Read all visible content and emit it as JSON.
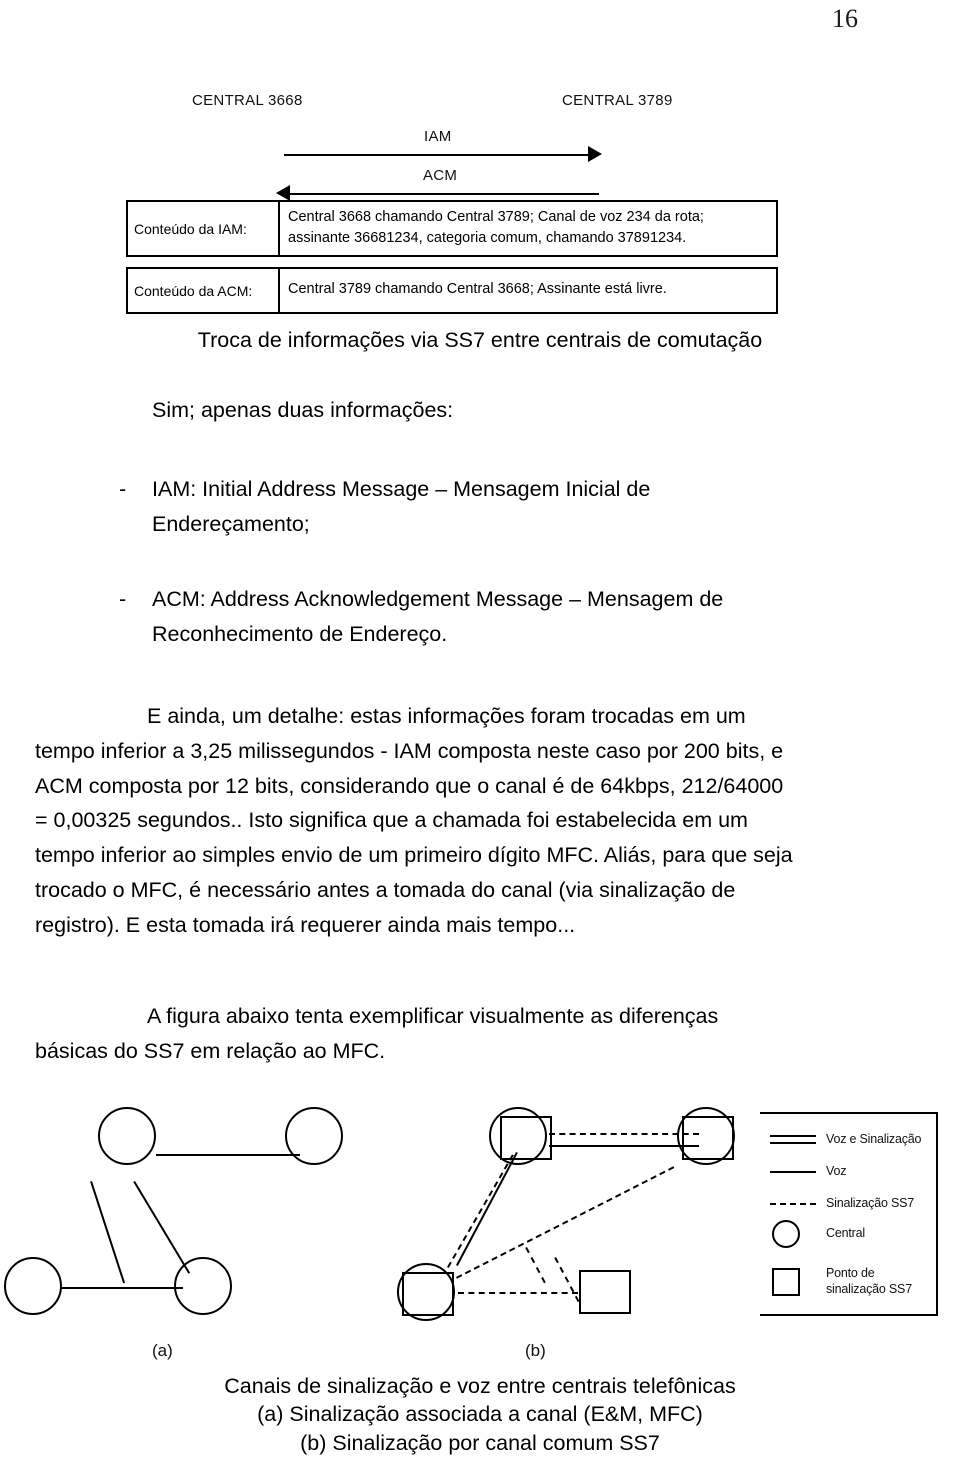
{
  "page": {
    "number": "16"
  },
  "figure_top": {
    "central_left": "CENTRAL 3668",
    "central_right": "CENTRAL 3789",
    "msg_forward": "IAM",
    "msg_backward": "ACM",
    "rows": [
      {
        "label": "Conteúdo da IAM:",
        "line1": "Central 3668 chamando Central 3789; Canal de voz 234 da rota;",
        "line2": "assinante 36681234, categoria comum, chamando 37891234."
      },
      {
        "label": "Conteúdo da ACM:",
        "line1": "Central 3789 chamando Central 3668; Assinante está livre.",
        "line2": ""
      }
    ],
    "caption": "Troca de informações via SS7 entre centrais de comutação"
  },
  "body": {
    "lead": "Sim; apenas duas informações:",
    "bullets": [
      {
        "dash": "-",
        "line1": "IAM: Initial Address Message – Mensagem Inicial de",
        "line2": "Endereçamento;"
      },
      {
        "dash": "-",
        "line1": "ACM: Address Acknowledgement Message – Mensagem de",
        "line2": "Reconhecimento de Endereço."
      }
    ],
    "paragraph_1": {
      "line1": "E ainda, um detalhe: estas informações foram trocadas em um",
      "line2": "tempo inferior a 3,25 milissegundos - IAM composta neste caso por 200 bits, e",
      "line3": "ACM composta por 12 bits, considerando que o canal é de 64kbps, 212/64000",
      "line4": "= 0,00325 segundos.. Isto significa que a chamada foi estabelecida em um",
      "line5": "tempo inferior ao simples envio de um primeiro dígito MFC. Aliás, para que seja",
      "line6": "trocado o MFC, é necessário antes a tomada do canal (via sinalização de",
      "line7": "registro). E esta tomada irá requerer ainda mais tempo..."
    },
    "paragraph_2": {
      "line1": "A figura abaixo tenta exemplificar visualmente as diferenças",
      "line2": "básicas do SS7 em relação ao MFC."
    }
  },
  "figure_bottom": {
    "sub_label_a": "(a)",
    "sub_label_b": "(b)",
    "legend": [
      {
        "symbol": "double-line",
        "text": "Voz e Sinalização"
      },
      {
        "symbol": "solid-line",
        "text": "Voz"
      },
      {
        "symbol": "dashed-line",
        "text": "Sinalização SS7"
      },
      {
        "symbol": "circle",
        "text": "Central"
      },
      {
        "symbol": "square",
        "text": "Ponto de sinalização SS7"
      }
    ],
    "caption_line1": "Canais de sinalização e voz entre centrais telefônicas",
    "caption_line2": "(a) Sinalização associada a canal (E&M, MFC)",
    "caption_line3": "(b) Sinalização por canal comum SS7"
  },
  "colors": {
    "ink": "#000000",
    "page_background": "#ffffff"
  }
}
